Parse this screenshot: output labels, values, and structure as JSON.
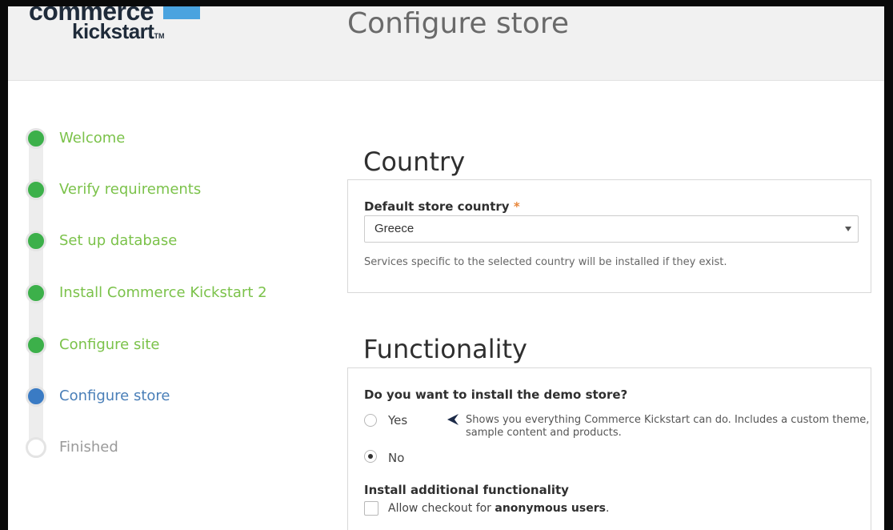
{
  "logo": {
    "line1": "commerce",
    "line2": "kickstart",
    "tm": "TM"
  },
  "page_title": "Configure store",
  "steps": [
    {
      "label": "Welcome",
      "state": "done"
    },
    {
      "label": "Verify requirements",
      "state": "done"
    },
    {
      "label": "Set up database",
      "state": "done"
    },
    {
      "label": "Install Commerce Kickstart 2",
      "state": "done"
    },
    {
      "label": "Configure site",
      "state": "done"
    },
    {
      "label": "Configure store",
      "state": "active"
    },
    {
      "label": "Finished",
      "state": "pending"
    }
  ],
  "country": {
    "heading": "Country",
    "field_label": "Default store country",
    "required_marker": "*",
    "selected": "Greece",
    "helper": "Services specific to the selected country will be installed if they exist."
  },
  "functionality": {
    "heading": "Functionality",
    "demo_question": "Do you want to install the demo store?",
    "options": [
      {
        "label": "Yes",
        "selected": false
      },
      {
        "label": "No",
        "selected": true
      }
    ],
    "yes_description": "Shows you everything Commerce Kickstart can do. Includes a custom theme, sample content and products.",
    "additional_label": "Install additional functionality",
    "checkbox_prefix": "Allow checkout for ",
    "checkbox_bold": "anonymous users",
    "checkbox_suffix": ".",
    "checkbox_checked": false
  },
  "colors": {
    "step_done": "#3cb04a",
    "step_active": "#3a7bc4",
    "required": "#e8863a"
  },
  "icons": {
    "select_arrow": "chevron-down-icon",
    "pointer": "arrow-left-icon"
  }
}
